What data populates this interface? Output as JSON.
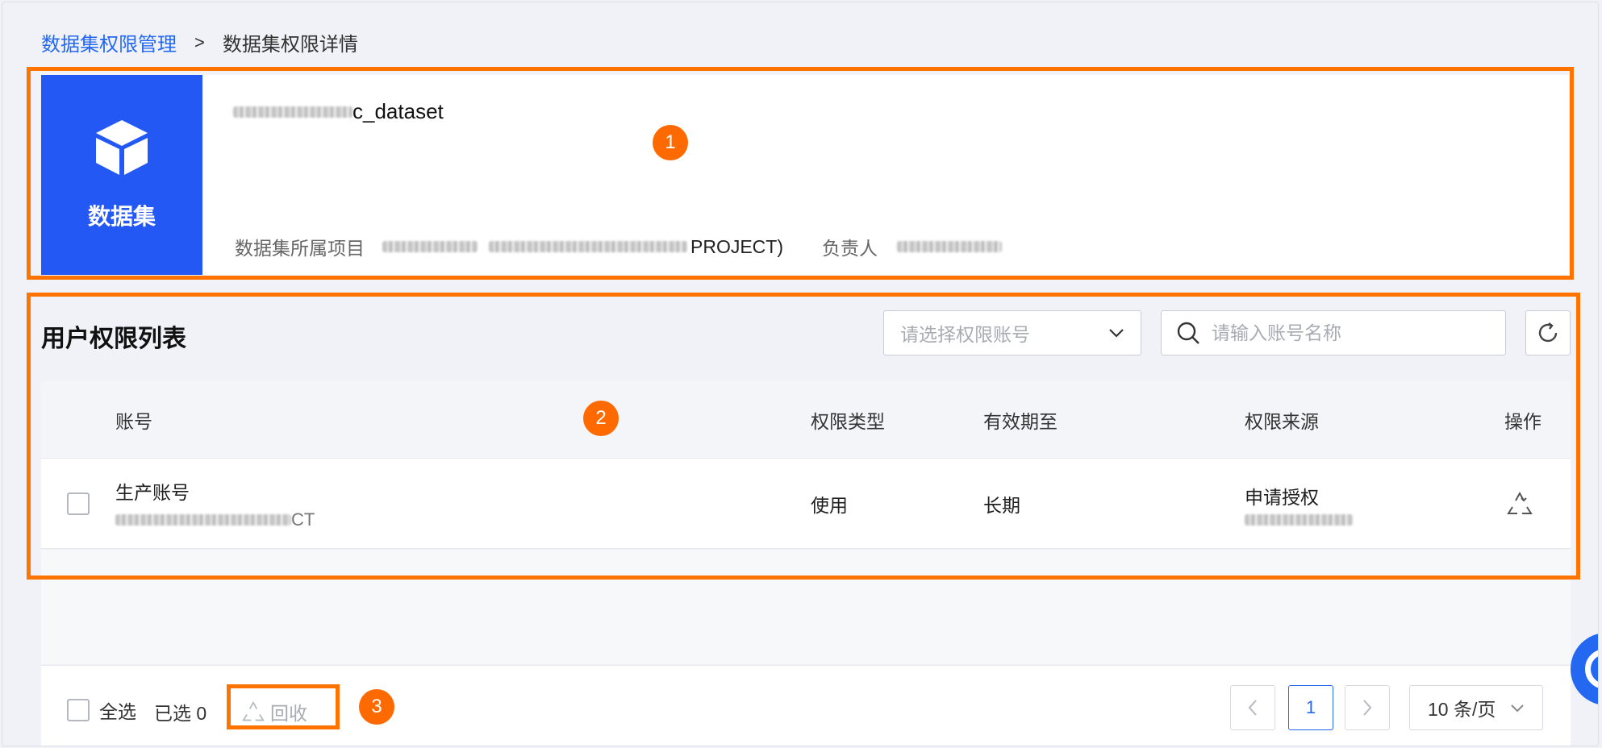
{
  "breadcrumb": {
    "parent": "数据集权限管理",
    "separator": ">",
    "current": "数据集权限详情"
  },
  "dataset": {
    "tile_label": "数据集",
    "name_suffix": "c_dataset",
    "project_label": "数据集所属项目",
    "project_suffix": "PROJECT)",
    "owner_label": "负责人"
  },
  "user_list": {
    "title": "用户权限列表",
    "account_select_placeholder": "请选择权限账号",
    "search_placeholder": "请输入账号名称"
  },
  "table": {
    "columns": [
      "账号",
      "权限类型",
      "有效期至",
      "权限来源",
      "操作"
    ],
    "rows": [
      {
        "account": "生产账号",
        "account_sub_suffix": "CT",
        "permission_type": "使用",
        "valid_until": "长期",
        "source": "申请授权"
      }
    ]
  },
  "footer": {
    "select_all": "全选",
    "selected_count": "已选 0",
    "recycle": "回收"
  },
  "pagination": {
    "current_page": "1",
    "page_size": "10 条/页"
  },
  "annotations": [
    "1",
    "2",
    "3"
  ],
  "colors": {
    "primary": "#2468f2",
    "dataset_tile": "#2458f5",
    "annotation": "#ff7300"
  },
  "icons": [
    "cube-icon",
    "chevron-down-icon",
    "search-icon",
    "refresh-icon",
    "recycle-icon",
    "chevron-left-icon",
    "chevron-right-icon"
  ]
}
